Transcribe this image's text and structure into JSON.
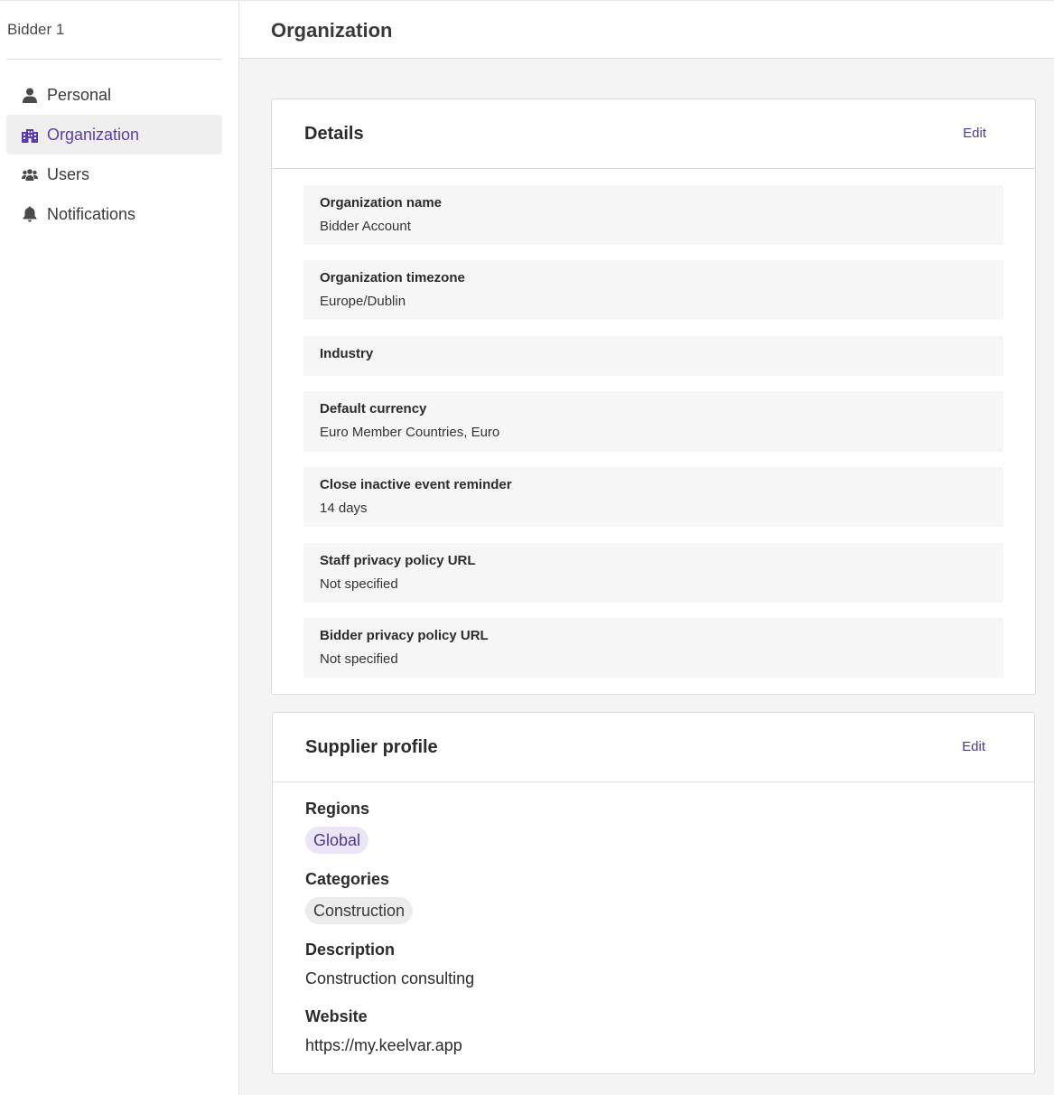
{
  "sidebar": {
    "user_name": "Bidder 1",
    "items": [
      {
        "label": "Personal",
        "icon": "user-icon"
      },
      {
        "label": "Organization",
        "icon": "building-icon",
        "active": true
      },
      {
        "label": "Users",
        "icon": "users-icon"
      },
      {
        "label": "Notifications",
        "icon": "bell-icon"
      }
    ]
  },
  "header": {
    "title": "Organization"
  },
  "details": {
    "title": "Details",
    "edit_label": "Edit",
    "fields": [
      {
        "label": "Organization name",
        "value": "Bidder Account"
      },
      {
        "label": "Organization timezone",
        "value": "Europe/Dublin"
      },
      {
        "label": "Industry",
        "value": ""
      },
      {
        "label": "Default currency",
        "value": "Euro Member Countries, Euro"
      },
      {
        "label": "Close inactive event reminder",
        "value": "14 days"
      },
      {
        "label": "Staff privacy policy URL",
        "value": "Not specified"
      },
      {
        "label": "Bidder privacy policy URL",
        "value": "Not specified"
      }
    ]
  },
  "supplier_profile": {
    "title": "Supplier profile",
    "edit_label": "Edit",
    "regions_label": "Regions",
    "regions": [
      "Global"
    ],
    "categories_label": "Categories",
    "categories": [
      "Construction"
    ],
    "description_label": "Description",
    "description": "Construction consulting",
    "website_label": "Website",
    "website": "https://my.keelvar.app"
  },
  "colors": {
    "accent": "#5b3bb5",
    "edit_link": "#4a3a8f",
    "region_chip_bg": "#ebe6f7",
    "category_chip_bg": "#ececec"
  }
}
